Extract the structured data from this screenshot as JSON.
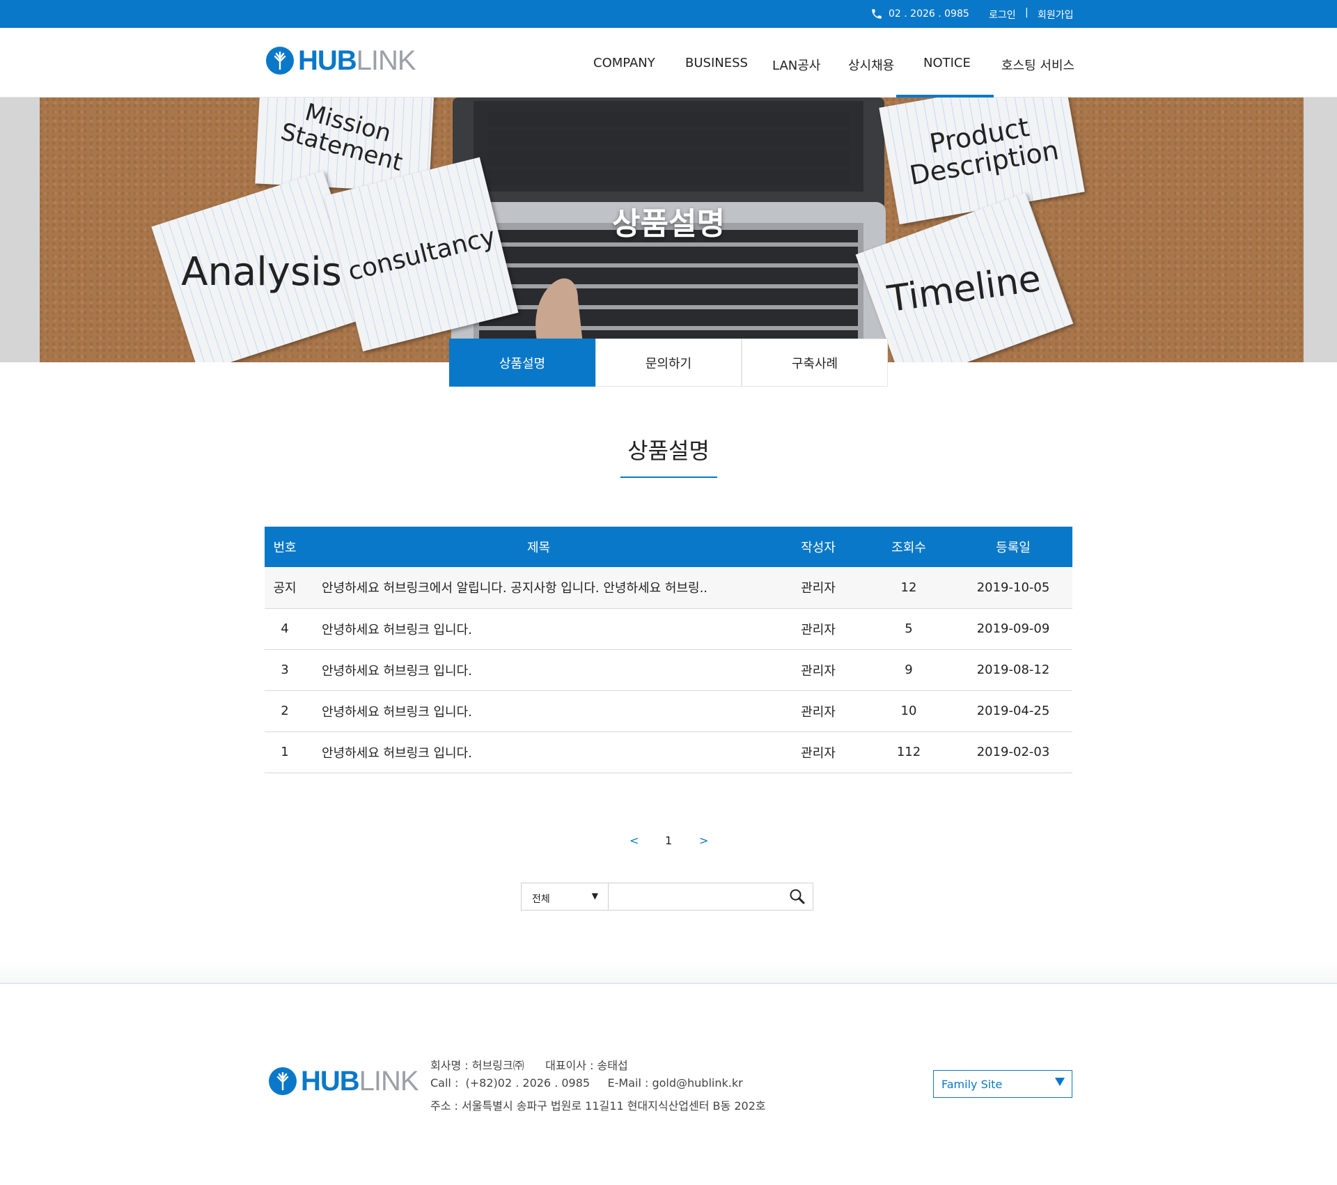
{
  "topbar": {
    "phone": "02 . 2026 . 0985",
    "login": "로그인",
    "separator": "|",
    "join": "회원가입"
  },
  "brand": {
    "hub": "HUB",
    "link": "LINK"
  },
  "nav": {
    "items": [
      "COMPANY",
      "BUSINESS",
      "LAN공사",
      "상시채용",
      "NOTICE",
      "호스팅 서비스"
    ],
    "active": "NOTICE"
  },
  "banner": {
    "title": "상품설명",
    "notes": [
      "Mission Statement",
      "Analysis",
      "consultancy",
      "Product Description",
      "Timeline"
    ]
  },
  "subtabs": [
    "상품설명",
    "문의하기",
    "구축사례"
  ],
  "section": {
    "title": "상품설명"
  },
  "table": {
    "headers": {
      "num": "번호",
      "title": "제목",
      "writer": "작성자",
      "views": "조회수",
      "date": "등록일"
    },
    "rows": [
      {
        "num": "공지",
        "title": "안녕하세요 허브링크에서 알립니다. 공지사항 입니다. 안녕하세요 허브링..",
        "writer": "관리자",
        "views": "12",
        "date": "2019-10-05"
      },
      {
        "num": "4",
        "title": "안녕하세요 허브링크 입니다.",
        "writer": "관리자",
        "views": "5",
        "date": "2019-09-09"
      },
      {
        "num": "3",
        "title": "안녕하세요 허브링크 입니다.",
        "writer": "관리자",
        "views": "9",
        "date": "2019-08-12"
      },
      {
        "num": "2",
        "title": "안녕하세요 허브링크 입니다.",
        "writer": "관리자",
        "views": "10",
        "date": "2019-04-25"
      },
      {
        "num": "1",
        "title": "안녕하세요 허브링크 입니다.",
        "writer": "관리자",
        "views": "112",
        "date": "2019-02-03"
      }
    ]
  },
  "pagination": {
    "prev": "<",
    "current": "1",
    "next": ">"
  },
  "search": {
    "scope": "전체",
    "value": ""
  },
  "footer": {
    "line1": "회사명 : 허브링크㈜      대표이사 : 송태섭",
    "line2": "Call :  (+82)02 . 2026 . 0985     E-Mail : gold@hublink.kr",
    "line3": "주소 : 서울특별시 송파구 법원로 11길11 현대지식산업센터 B동 202호",
    "family_site": "Family Site"
  },
  "colors": {
    "primary": "#0a78c8",
    "gray_text": "#9aa0a6"
  }
}
